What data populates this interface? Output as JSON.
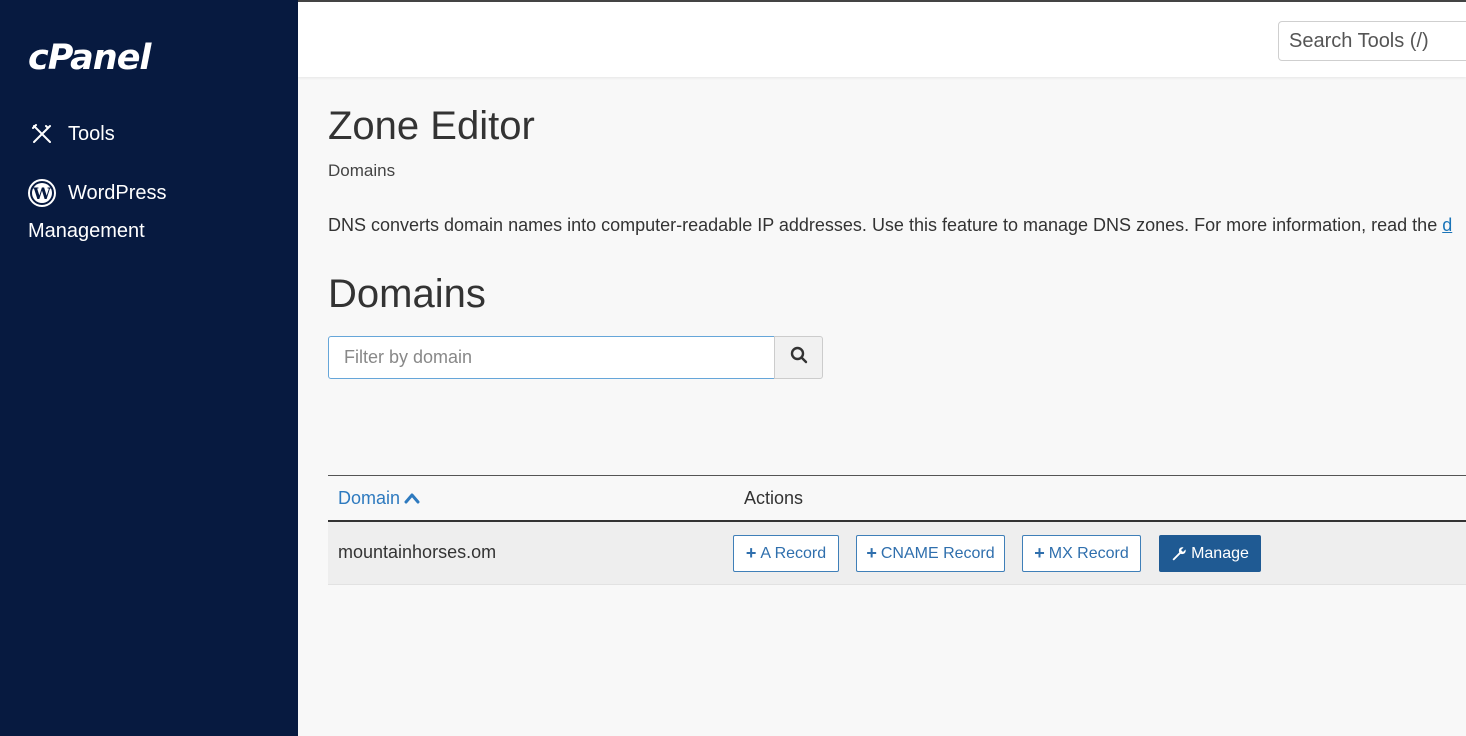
{
  "sidebar": {
    "logo": "cPanel",
    "items": [
      {
        "label": "Tools",
        "icon": "tools-icon"
      },
      {
        "label": "WordPress",
        "label_line2": "Management",
        "icon": "wordpress-icon"
      }
    ]
  },
  "header": {
    "search_placeholder": "Search Tools (/)"
  },
  "main": {
    "title": "Zone Editor",
    "breadcrumb": "Domains",
    "intro_text": "DNS converts domain names into computer-readable IP addresses. Use this feature to manage DNS zones. For more information, read the ",
    "intro_link": "d",
    "section_title": "Domains",
    "filter_placeholder": "Filter by domain"
  },
  "table": {
    "col_domain": "Domain",
    "col_actions": "Actions",
    "rows": [
      {
        "domain": "mountainhorses.om",
        "actions": {
          "a_record": "A Record",
          "cname_record": "CNAME Record",
          "mx_record": "MX Record",
          "manage": "Manage"
        }
      }
    ]
  },
  "colors": {
    "sidebar_bg": "#071a40",
    "link_blue": "#2e7abf",
    "primary_button": "#1f5a93"
  }
}
